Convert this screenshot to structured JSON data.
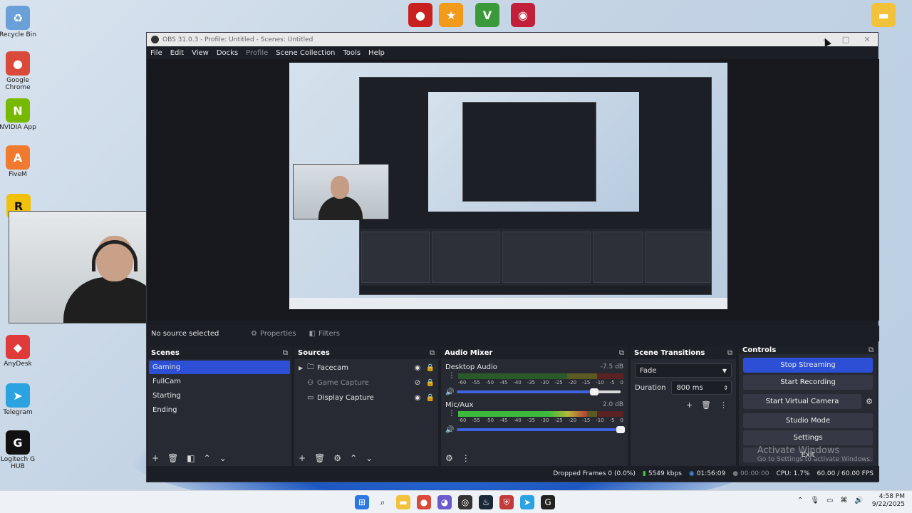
{
  "desktop": {
    "left_icons": [
      {
        "label": "Recycle Bin",
        "glyph": "♻",
        "color": "#6aa0d8"
      },
      {
        "label": "Google Chrome",
        "glyph": "●",
        "color": "#d94a3a"
      },
      {
        "label": "NVIDIA App",
        "glyph": "N",
        "color": "#76b900"
      },
      {
        "label": "FiveM",
        "glyph": "A",
        "color": "#f07a30"
      },
      {
        "label": "AnyDesk",
        "glyph": "◆",
        "color": "#e03a3a"
      },
      {
        "label": "Telegram",
        "glyph": "➤",
        "color": "#2aa3e0"
      },
      {
        "label": "Logitech G HUB",
        "glyph": "G",
        "color": "#111111"
      }
    ]
  },
  "window": {
    "title": "OBS 31.0.3 - Profile: Untitled - Scenes: Untitled",
    "menu": [
      "File",
      "Edit",
      "View",
      "Docks",
      "Profile",
      "Scene Collection",
      "Tools",
      "Help"
    ]
  },
  "properties_bar": {
    "status": "No source selected",
    "properties_label": "Properties",
    "filters_label": "Filters"
  },
  "scenes": {
    "title": "Scenes",
    "items": [
      {
        "name": "Gaming",
        "selected": true
      },
      {
        "name": "FullCam",
        "selected": false
      },
      {
        "name": "Starting",
        "selected": false
      },
      {
        "name": "Ending",
        "selected": false
      }
    ]
  },
  "sources": {
    "title": "Sources",
    "items": [
      {
        "name": "Facecam",
        "type": "group",
        "visible": true
      },
      {
        "name": "Game Capture",
        "type": "game",
        "visible": false
      },
      {
        "name": "Display Capture",
        "type": "display",
        "visible": true
      }
    ]
  },
  "audio_mixer": {
    "title": "Audio Mixer",
    "channels": [
      {
        "name": "Desktop Audio",
        "db": "-7.5 dB",
        "level": 0,
        "volume": 0.84
      },
      {
        "name": "Mic/Aux",
        "db": "2.0 dB",
        "level": 0.78,
        "volume": 1.0
      }
    ],
    "ticks": [
      "-60",
      "-55",
      "-50",
      "-45",
      "-40",
      "-35",
      "-30",
      "-25",
      "-20",
      "-15",
      "-10",
      "-5",
      "0"
    ]
  },
  "scene_transitions": {
    "title": "Scene Transitions",
    "transition": "Fade",
    "duration_label": "Duration",
    "duration_value": "800 ms"
  },
  "controls": {
    "title": "Controls",
    "stop_streaming": "Stop Streaming",
    "start_recording": "Start Recording",
    "start_virtual_camera": "Start Virtual Camera",
    "studio_mode": "Studio Mode",
    "settings": "Settings",
    "exit": "Exit"
  },
  "activation": {
    "line1": "Activate Windows",
    "line2": "Go to Settings to activate Windows."
  },
  "statusbar": {
    "dropped_frames": "Dropped Frames 0 (0.0%)",
    "bitrate": "5549 kbps",
    "stream_time": "01:56:09",
    "record_time": "00:00:00",
    "cpu": "CPU: 1.7%",
    "fps": "60.00 / 60.00 FPS"
  },
  "taskbar": {
    "time": "4:58 PM",
    "date": "9/22/2025"
  },
  "colors": {
    "accent": "#2c4fd6",
    "meter_green": "#3fc43f"
  }
}
